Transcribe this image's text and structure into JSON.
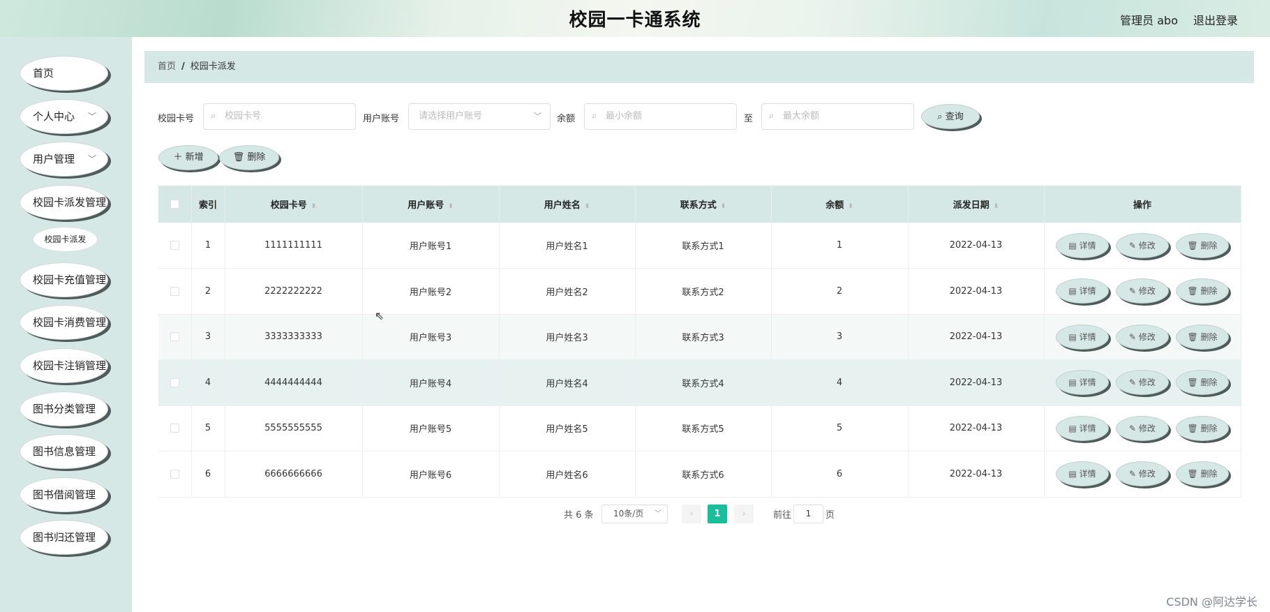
{
  "header": {
    "title": "校园一卡通系统",
    "user": "管理员 abo",
    "logout": "退出登录"
  },
  "sidebar": {
    "items": [
      {
        "label": "首页",
        "chevron": false
      },
      {
        "label": "个人中心",
        "chevron": true
      },
      {
        "label": "用户管理",
        "chevron": true
      },
      {
        "label": "校园卡派发管理",
        "chevron": false
      },
      {
        "label": "校园卡充值管理",
        "chevron": false
      },
      {
        "label": "校园卡消费管理",
        "chevron": false
      },
      {
        "label": "校园卡注销管理",
        "chevron": false
      },
      {
        "label": "图书分类管理",
        "chevron": false
      },
      {
        "label": "图书信息管理",
        "chevron": false
      },
      {
        "label": "图书借阅管理",
        "chevron": false
      },
      {
        "label": "图书归还管理",
        "chevron": false
      }
    ],
    "sub_item": "校园卡派发"
  },
  "breadcrumb": {
    "home": "首页",
    "separator": "/",
    "current": "校园卡派发"
  },
  "search": {
    "card_label": "校园卡号",
    "card_placeholder": "校园卡号",
    "account_label": "用户账号",
    "account_placeholder": "请选择用户账号",
    "balance_label": "余额",
    "min_placeholder": "最小余额",
    "to_label": "至",
    "max_placeholder": "最大余额",
    "query_button": "查询"
  },
  "actions": {
    "add": "新增",
    "delete": "删除"
  },
  "table": {
    "headers": [
      "索引",
      "校园卡号",
      "用户账号",
      "用户姓名",
      "联系方式",
      "余额",
      "派发日期",
      "操作"
    ],
    "rows": [
      [
        "1",
        "1111111111",
        "用户账号1",
        "用户姓名1",
        "联系方式1",
        "1",
        "2022-04-13"
      ],
      [
        "2",
        "2222222222",
        "用户账号2",
        "用户姓名2",
        "联系方式2",
        "2",
        "2022-04-13"
      ],
      [
        "3",
        "3333333333",
        "用户账号3",
        "用户姓名3",
        "联系方式3",
        "3",
        "2022-04-13"
      ],
      [
        "4",
        "4444444444",
        "用户账号4",
        "用户姓名4",
        "联系方式4",
        "4",
        "2022-04-13"
      ],
      [
        "5",
        "5555555555",
        "用户账号5",
        "用户姓名5",
        "联系方式5",
        "5",
        "2022-04-13"
      ],
      [
        "6",
        "6666666666",
        "用户账号6",
        "用户姓名6",
        "联系方式6",
        "6",
        "2022-04-13"
      ]
    ],
    "row_buttons": {
      "detail": "详情",
      "edit": "修改",
      "delete": "删除"
    }
  },
  "pagination": {
    "total": "共 6 条",
    "page_size": "10条/页",
    "current_page": "1",
    "goto_prefix": "前往",
    "goto_value": "1",
    "goto_suffix": "页"
  },
  "watermark": "CSDN @阿达学长",
  "colors": {
    "accent": "#19be9b",
    "panel": "#d6e8e6"
  }
}
